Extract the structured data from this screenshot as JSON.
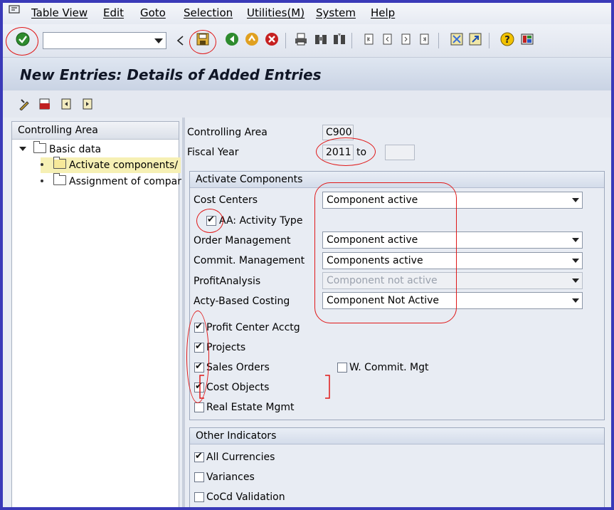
{
  "menu": {
    "items": [
      "Table View",
      "Edit",
      "Goto",
      "Selection",
      "Utilities(M)",
      "System",
      "Help"
    ]
  },
  "toolbar": {
    "command_field_value": "",
    "buttons": [
      "enter-icon",
      "save-icon",
      "back-icon",
      "exit-icon",
      "cancel-icon",
      "print-icon",
      "find-icon",
      "find-next-icon",
      "first-page-icon",
      "previous-page-icon",
      "next-page-icon",
      "last-page-icon",
      "create-session-icon",
      "shortcut-icon",
      "help-icon",
      "layout-icon"
    ]
  },
  "title": "New Entries: Details of Added Entries",
  "tree": {
    "header": "Controlling Area",
    "items": [
      "Basic data",
      "Activate components/",
      "Assignment of compar"
    ]
  },
  "header_fields": {
    "controlling_area_label": "Controlling Area",
    "controlling_area_value": "C900",
    "fiscal_year_label": "Fiscal Year",
    "fiscal_year_value": "2011",
    "to_label": "to",
    "fiscal_year_to_value": ""
  },
  "activate_components": {
    "title": "Activate Components",
    "cost_centers_label": "Cost Centers",
    "cost_centers_value": "Component active",
    "activity_type_label": "AA: Activity Type",
    "order_mgmt_label": "Order Management",
    "order_mgmt_value": "Component active",
    "commit_mgmt_label": "Commit. Management",
    "commit_mgmt_value": "Components active",
    "profit_analysis_label": "ProfitAnalysis",
    "profit_analysis_value": "Component not active",
    "abc_label": "Acty-Based Costing",
    "abc_value": "Component Not Active",
    "profit_center_label": "Profit Center Acctg",
    "projects_label": "Projects",
    "sales_orders_label": "Sales Orders",
    "w_commit_label": "W. Commit. Mgt",
    "cost_objects_label": "Cost Objects",
    "real_estate_label": "Real Estate Mgmt"
  },
  "other_indicators": {
    "title": "Other Indicators",
    "all_currencies_label": "All Currencies",
    "variances_label": "Variances",
    "cocd_validation_label": "CoCd Validation"
  },
  "colors": {
    "highlight": "#e01818",
    "border": "#3a3ab8"
  }
}
